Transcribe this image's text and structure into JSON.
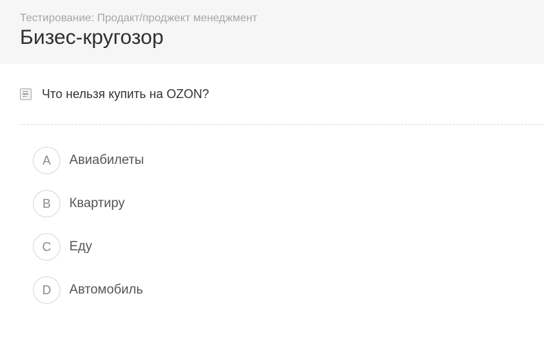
{
  "header": {
    "breadcrumb": "Тестирование: Продакт/проджект менеджмент",
    "title": "Бизес-кругозор"
  },
  "question": {
    "icon": "document-icon",
    "text": "Что нельзя купить на OZON?"
  },
  "options": [
    {
      "letter": "A",
      "text": "Авиабилеты"
    },
    {
      "letter": "B",
      "text": "Квартиру"
    },
    {
      "letter": "C",
      "text": "Еду"
    },
    {
      "letter": "D",
      "text": "Автомобиль"
    }
  ]
}
